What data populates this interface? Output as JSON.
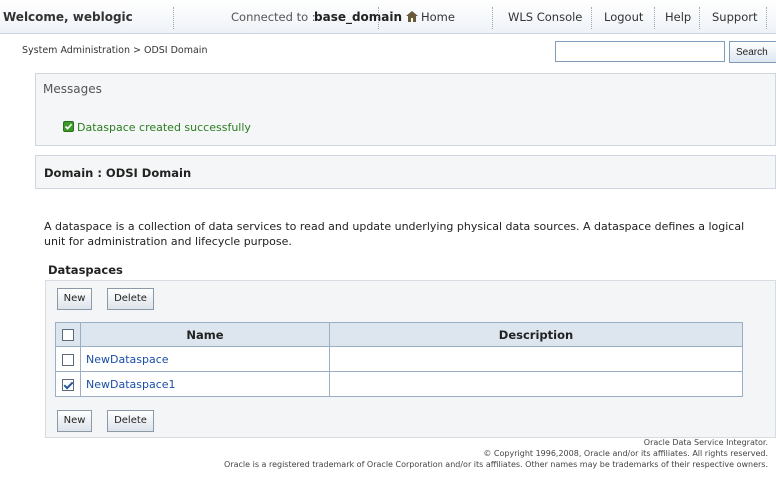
{
  "header": {
    "welcome": "Welcome, weblogic",
    "connected_label": "Connected to :",
    "domain": "base_domain",
    "nav": {
      "home": "Home",
      "wls_console": "WLS Console",
      "logout": "Logout",
      "help": "Help",
      "support": "Support"
    }
  },
  "breadcrumb": "System Administration > ODSI Domain",
  "search": {
    "value": "",
    "button": "Search"
  },
  "messages": {
    "title": "Messages",
    "success": "Dataspace created successfully",
    "success_color": "#2a7d1f"
  },
  "domain": {
    "title": "Domain : ODSI Domain",
    "description": "A dataspace is a collection of data services to read and update underlying physical data sources. A dataspace defines a logical unit for administration and lifecycle purpose."
  },
  "dataspaces": {
    "title": "Dataspaces",
    "new_label": "New",
    "delete_label": "Delete",
    "columns": [
      "Name",
      "Description"
    ],
    "rows": [
      {
        "name": "NewDataspace",
        "description": "",
        "checked": false
      },
      {
        "name": "NewDataspace1",
        "description": "",
        "checked": true
      }
    ]
  },
  "footer": {
    "product": "Oracle Data Service Integrator.",
    "copyright": "© Copyright 1996,2008, Oracle and/or its affiliates. All rights reserved.",
    "trademark": "Oracle is a registered trademark of Oracle Corporation and/or its affiliates. Other names may be trademarks of their respective owners."
  }
}
